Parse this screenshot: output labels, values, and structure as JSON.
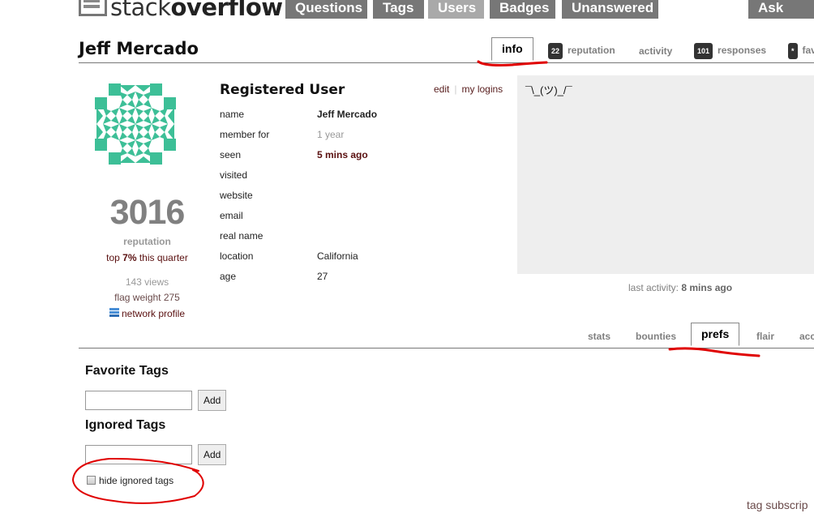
{
  "site": {
    "logo_light": "stack",
    "logo_bold": "overflow",
    "nav": [
      {
        "label": "Questions",
        "selected": false
      },
      {
        "label": "Tags",
        "selected": false
      },
      {
        "label": "Users",
        "selected": true
      },
      {
        "label": "Badges",
        "selected": false
      },
      {
        "label": "Unanswered",
        "selected": false
      }
    ],
    "ask_label": "Ask Ques"
  },
  "profile": {
    "display_name": "Jeff Mercado",
    "tabs": [
      {
        "label": "info",
        "active": true
      },
      {
        "label": "reputation",
        "badge": "22"
      },
      {
        "label": "activity"
      },
      {
        "label": "responses",
        "badge": "101"
      },
      {
        "label": "fav",
        "badge": "*"
      }
    ],
    "avatar_color": "#3dbf97",
    "reputation": "3016",
    "reputation_label": "reputation",
    "top_prefix": "top ",
    "top_percent": "7%",
    "top_suffix": " this quarter",
    "views": "143 views",
    "flag_weight": "flag weight 275",
    "network_profile": "network profile",
    "section_title": "Registered User",
    "edit_label": "edit",
    "logins_label": "my logins",
    "fields": [
      {
        "label": "name",
        "value": "Jeff Mercado"
      },
      {
        "label": "member for",
        "value": "1 year"
      },
      {
        "label": "seen",
        "value": "5 mins ago"
      },
      {
        "label": "visited",
        "value": ""
      },
      {
        "label": "website",
        "value": ""
      },
      {
        "label": "email",
        "value": ""
      },
      {
        "label": "real name",
        "value": ""
      },
      {
        "label": "location",
        "value": "California"
      },
      {
        "label": "age",
        "value": "27"
      }
    ],
    "about_me": "¯\\_(ツ)_/¯",
    "last_activity_label": "last activity: ",
    "last_activity_value": "8 mins ago"
  },
  "subtabs": [
    {
      "label": "stats"
    },
    {
      "label": "bounties"
    },
    {
      "label": "prefs",
      "active": true
    },
    {
      "label": "flair"
    },
    {
      "label": "acc"
    }
  ],
  "prefs": {
    "favorite_title": "Favorite Tags",
    "favorite_value": "",
    "ignored_title": "Ignored Tags",
    "ignored_value": "",
    "add_label": "Add",
    "hide_ignored_label": "hide ignored tags",
    "hide_ignored_checked": false,
    "tag_subscriptions": "tag subscrip"
  },
  "annotation_color": "#e00000"
}
